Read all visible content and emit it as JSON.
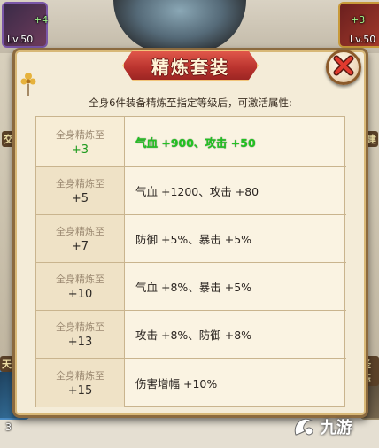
{
  "background": {
    "hero_left_level": "Lv.50",
    "hero_left_badge": "+4",
    "hero_right_level": "Lv.50",
    "hero_right_badge": "+3",
    "side_left_tag": "交",
    "side_right_tag": "建",
    "bottom_left_tag": "天赋",
    "bottom_right_tag": "圣珏",
    "bottom_left_count": "3"
  },
  "dialog": {
    "title": "精炼套装",
    "close_icon": "close-x-icon",
    "subtitle": "全身6件装备精炼至指定等级后，可激活属性:",
    "requirement_label": "全身精炼至",
    "rows": [
      {
        "level": "+3",
        "bonus": "气血 +900、攻击 +50",
        "active": true
      },
      {
        "level": "+5",
        "bonus": "气血 +1200、攻击 +80",
        "active": false
      },
      {
        "level": "+7",
        "bonus": "防御 +5%、暴击 +5%",
        "active": false
      },
      {
        "level": "+10",
        "bonus": "气血 +8%、暴击 +5%",
        "active": false
      },
      {
        "level": "+13",
        "bonus": "攻击 +8%、防御 +8%",
        "active": false
      },
      {
        "level": "+15",
        "bonus": "伤害增幅 +10%",
        "active": false
      }
    ],
    "colors": {
      "active": "#22c322",
      "title_red": "#b8322d",
      "panel_bg": "#f4ecd8",
      "border": "#8b6a3f"
    }
  },
  "watermark": {
    "text": "九游",
    "icon": "jiuyou-logo-icon"
  }
}
